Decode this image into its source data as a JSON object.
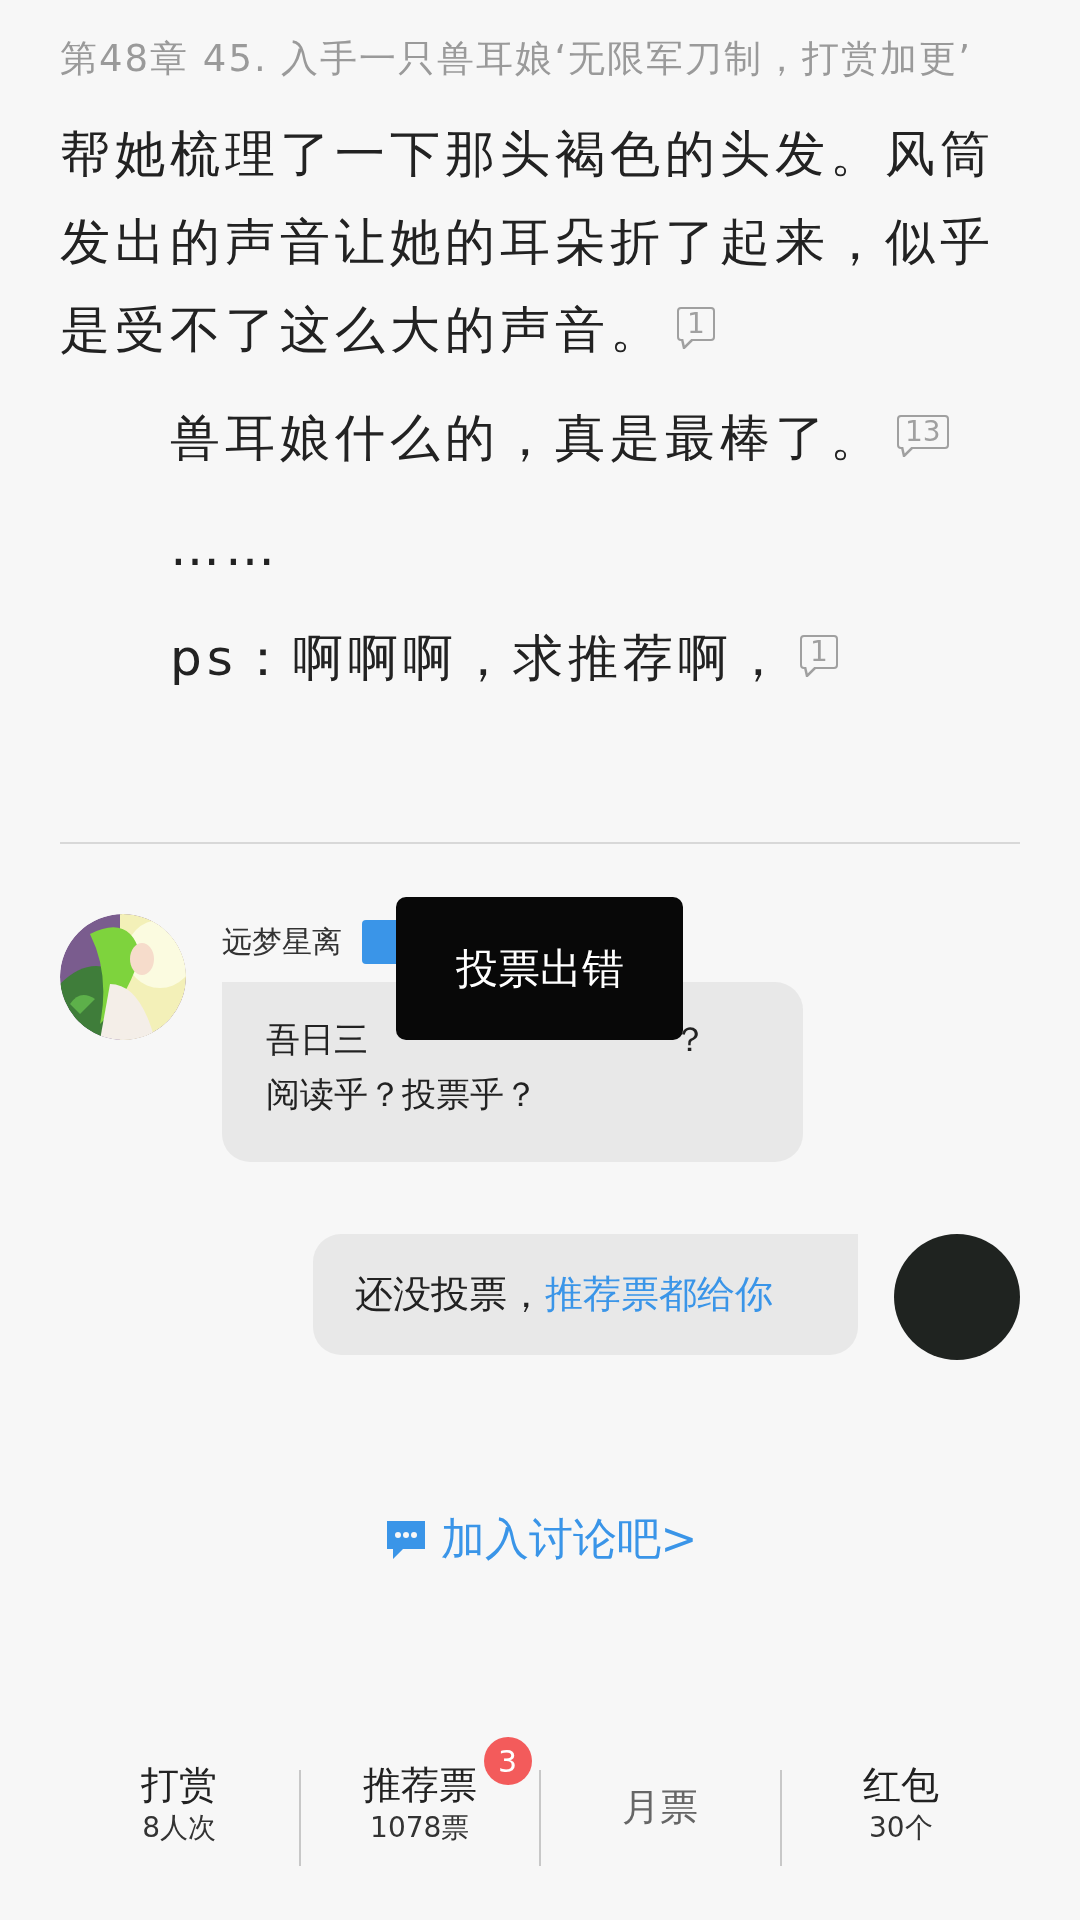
{
  "chapter_title": "第48章 45. 入手一只兽耳娘‘无限军刀制，打赏加更’",
  "paragraphs": [
    {
      "text": "帮她梳理了一下那头褐色的头发。风筒发出的声音让她的耳朵折了起来，似乎是受不了这么大的声音。",
      "indent": false,
      "comments": "1"
    },
    {
      "text": "兽耳娘什么的，真是最棒了。",
      "indent": true,
      "comments": "13"
    },
    {
      "text": "……",
      "indent": true
    },
    {
      "text": "ps：啊啊啊，求推荐啊，",
      "indent": true,
      "comments": "1"
    }
  ],
  "messages": [
    {
      "kind": "received",
      "author": "远梦星离",
      "author_badge": true,
      "avatar": {
        "kind": "picture"
      },
      "lines": [
        [
          "吾日三",
          "？"
        ],
        [
          "阅读乎？投票乎？"
        ]
      ]
    },
    {
      "kind": "sent",
      "avatar": {
        "kind": "plain"
      },
      "text": "还没投票，",
      "link": "推荐票都给你"
    }
  ],
  "toast": "投票出错",
  "join_link": "加入讨论吧>",
  "bottom_bar": [
    {
      "label": "打赏",
      "count": "8人次",
      "disabled": false
    },
    {
      "label": "推荐票",
      "count": "1078票",
      "badge": "3",
      "disabled": false
    },
    {
      "label": "月票",
      "disabled": true
    },
    {
      "label": "红包",
      "count": "30个",
      "disabled": false
    }
  ]
}
